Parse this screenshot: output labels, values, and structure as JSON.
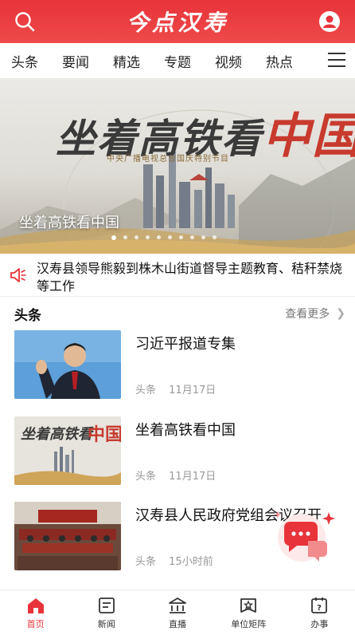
{
  "header": {
    "title": "今点汉寿",
    "search_icon": "search-icon",
    "user_icon": "user-icon",
    "brand_color": "#e8333a"
  },
  "tabs": [
    {
      "label": "头条"
    },
    {
      "label": "要闻"
    },
    {
      "label": "精选"
    },
    {
      "label": "专题"
    },
    {
      "label": "视频"
    },
    {
      "label": "热点"
    }
  ],
  "banner": {
    "art_text_1": "坐着高铁看",
    "art_text_2": "中国",
    "subtitle": "中央广播电视总台国庆特别节目",
    "caption": "坐着高铁看中国",
    "slide_count": 10,
    "active_slide": 1
  },
  "notice": {
    "icon": "speaker-icon",
    "text": "汉寿县领导熊毅到株木山街道督导主题教育、秸秆禁烧等工作"
  },
  "section": {
    "title": "头条",
    "more_label": "查看更多"
  },
  "news": [
    {
      "title": "习近平报道专集",
      "source": "头条",
      "time": "11月17日"
    },
    {
      "title": "坐着高铁看中国",
      "source": "头条",
      "time": "11月17日"
    },
    {
      "title": "汉寿县人民政府党组会议召开",
      "source": "头条",
      "time": "15小时前"
    }
  ],
  "bottom_nav": [
    {
      "label": "首页",
      "icon": "home-icon",
      "active": true
    },
    {
      "label": "新闻",
      "icon": "news-icon",
      "active": false
    },
    {
      "label": "直播",
      "icon": "live-icon",
      "active": false
    },
    {
      "label": "单位矩阵",
      "icon": "matrix-icon",
      "active": false
    },
    {
      "label": "办事",
      "icon": "service-icon",
      "active": false
    }
  ]
}
